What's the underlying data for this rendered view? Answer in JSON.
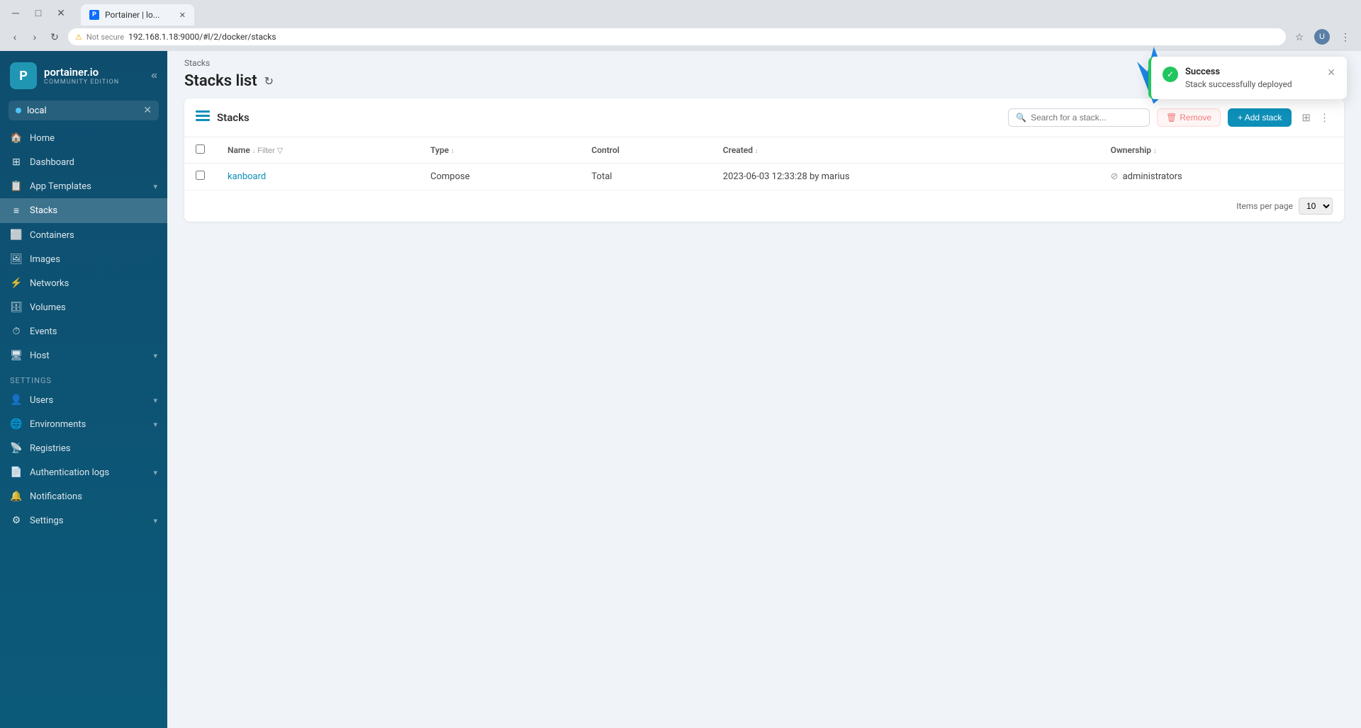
{
  "browser": {
    "tab_title": "Portainer | lo...",
    "address": "192.168.1.18:9000/#l/2/docker/stacks",
    "security_label": "Not secure"
  },
  "sidebar": {
    "logo_main": "portainer.io",
    "logo_sub": "Community Edition",
    "env_name": "local",
    "nav_items": [
      {
        "id": "home",
        "label": "Home",
        "icon": "🏠"
      },
      {
        "id": "dashboard",
        "label": "Dashboard",
        "icon": "📊"
      },
      {
        "id": "app-templates",
        "label": "App Templates",
        "icon": "📋",
        "has_chevron": true
      },
      {
        "id": "stacks",
        "label": "Stacks",
        "icon": "☰",
        "active": true
      },
      {
        "id": "containers",
        "label": "Containers",
        "icon": "🔲"
      },
      {
        "id": "images",
        "label": "Images",
        "icon": "🖼"
      },
      {
        "id": "networks",
        "label": "Networks",
        "icon": "🔗"
      },
      {
        "id": "volumes",
        "label": "Volumes",
        "icon": "💾"
      },
      {
        "id": "events",
        "label": "Events",
        "icon": "⏱"
      },
      {
        "id": "host",
        "label": "Host",
        "icon": "🖥",
        "has_chevron": true
      }
    ],
    "settings_label": "Settings",
    "settings_items": [
      {
        "id": "users",
        "label": "Users",
        "icon": "👤",
        "has_chevron": true
      },
      {
        "id": "environments",
        "label": "Environments",
        "icon": "🌐",
        "has_chevron": true
      },
      {
        "id": "registries",
        "label": "Registries",
        "icon": "📡"
      },
      {
        "id": "auth-logs",
        "label": "Authentication logs",
        "icon": "📄",
        "has_chevron": true
      },
      {
        "id": "notifications",
        "label": "Notifications",
        "icon": "🔔"
      },
      {
        "id": "settings",
        "label": "Settings",
        "icon": "⚙",
        "has_chevron": true
      }
    ]
  },
  "page": {
    "breadcrumb": "Stacks",
    "title": "Stacks list"
  },
  "stacks_panel": {
    "icon": "≡",
    "title": "Stacks",
    "search_placeholder": "Search for a stack...",
    "remove_label": "Remove",
    "add_stack_label": "+ Add stack",
    "table_headers": [
      {
        "id": "name",
        "label": "Name",
        "sortable": true
      },
      {
        "id": "type",
        "label": "Type",
        "sortable": true
      },
      {
        "id": "control",
        "label": "Control"
      },
      {
        "id": "created",
        "label": "Created",
        "sortable": true
      },
      {
        "id": "ownership",
        "label": "Ownership",
        "sortable": true
      }
    ],
    "filter_label": "Filter",
    "rows": [
      {
        "name": "kanboard",
        "type": "Compose",
        "control": "Total",
        "created": "2023-06-03 12:33:28 by marius",
        "ownership": "administrators"
      }
    ],
    "items_per_page_label": "Items per page",
    "items_per_page_value": "10"
  },
  "toast": {
    "status": "Success",
    "message": "Stack successfully deployed"
  }
}
